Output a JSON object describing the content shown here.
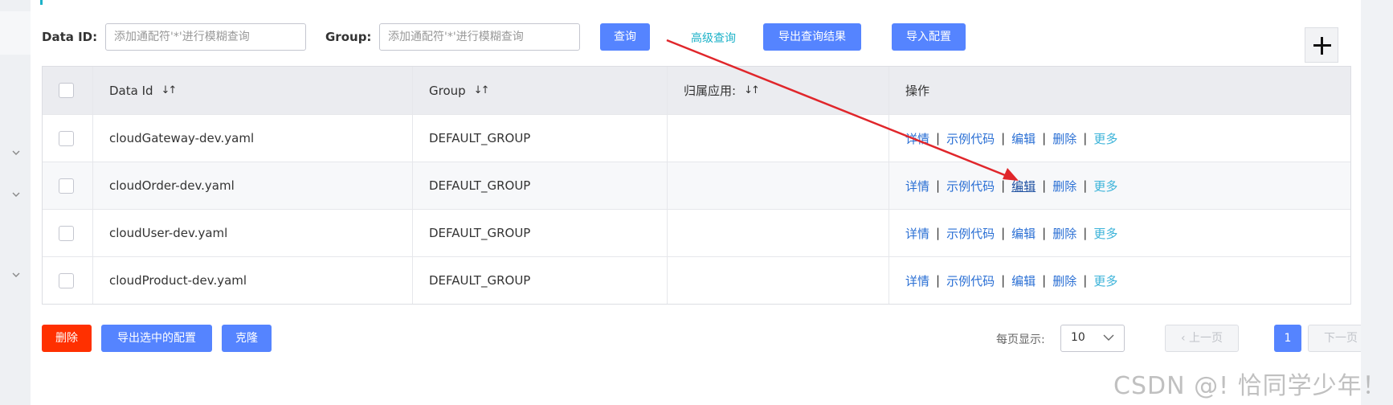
{
  "search": {
    "data_id_label": "Data ID:",
    "data_id_placeholder": "添加通配符'*'进行模糊查询",
    "group_label": "Group:",
    "group_placeholder": "添加通配符'*'进行模糊查询",
    "query_button": "查询",
    "advanced_query": "高级查询",
    "export_results_button": "导出查询结果",
    "import_config_button": "导入配置"
  },
  "table": {
    "headers": [
      "Data Id",
      "Group",
      "归属应用:",
      "操作"
    ],
    "sort_icon": "sort-icon",
    "rows": [
      {
        "data_id": "cloudGateway-dev.yaml",
        "group": "DEFAULT_GROUP",
        "app": ""
      },
      {
        "data_id": "cloudOrder-dev.yaml",
        "group": "DEFAULT_GROUP",
        "app": ""
      },
      {
        "data_id": "cloudUser-dev.yaml",
        "group": "DEFAULT_GROUP",
        "app": ""
      },
      {
        "data_id": "cloudProduct-dev.yaml",
        "group": "DEFAULT_GROUP",
        "app": ""
      }
    ],
    "actions": {
      "details": "详情",
      "sample_code": "示例代码",
      "edit": "编辑",
      "delete": "删除",
      "more": "更多",
      "separator": "|"
    }
  },
  "footer": {
    "delete_button": "删除",
    "export_selected_button": "导出选中的配置",
    "clone_button": "克隆",
    "page_size_label": "每页显示:",
    "page_size_value": "10",
    "prev_page": "上一页",
    "current_page": "1",
    "next_page": "下一页"
  },
  "watermark": "CSDN @! 恰同学少年！",
  "colors": {
    "primary": "#5584ff",
    "danger": "#ff3000",
    "link": "#2a6fd4",
    "accent_link": "#1db2c8",
    "annotation_arrow": "#e0262b"
  }
}
